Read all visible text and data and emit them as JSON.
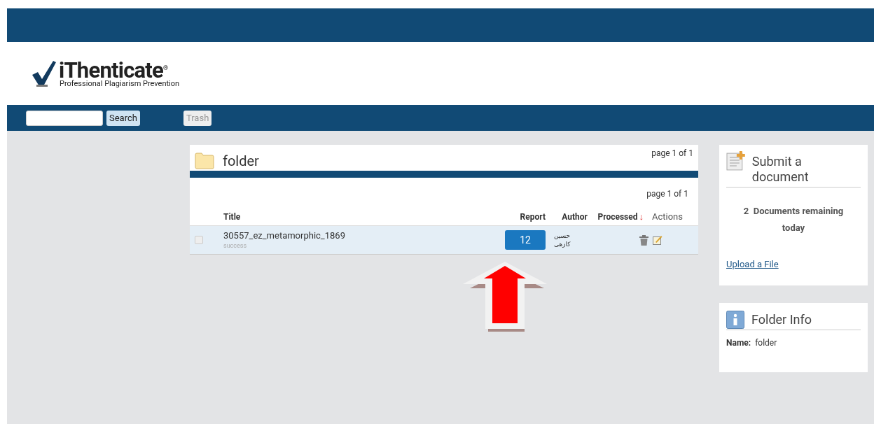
{
  "logo": {
    "name": "iThenticate",
    "mark": "®",
    "tagline": "Professional Plagiarism Prevention"
  },
  "nav": {
    "search_button": "Search",
    "trash_button": "Trash",
    "trash_disabled": true
  },
  "folder": {
    "title": "folder",
    "pager_top": "page 1 of 1",
    "pager": "page 1 of 1",
    "columns": [
      {
        "label": "Title",
        "bold": true
      },
      {
        "label": "Report",
        "bold": true
      },
      {
        "label": "Author",
        "bold": true
      },
      {
        "label": "Processed",
        "bold": true,
        "sort": "↓"
      },
      {
        "label": "Actions",
        "bold": false
      }
    ],
    "rows": [
      {
        "title": "30557_ez_metamorphic_1869",
        "status": "success",
        "report": "12",
        "author": "حسین کازهی",
        "checked": false
      }
    ]
  },
  "submit": {
    "title": "Submit a document",
    "count": "2",
    "remaining": "Documents remaining today",
    "upload_link": "Upload a File"
  },
  "folder_info": {
    "title": "Folder Info",
    "name_label": "Name:",
    "name_value": "folder"
  }
}
